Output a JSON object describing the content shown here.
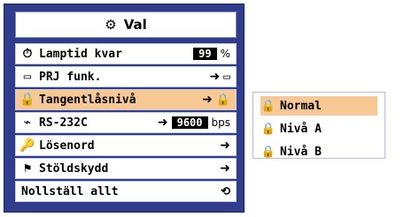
{
  "title": {
    "label": "Val",
    "icon": "options-icon"
  },
  "menu": {
    "items": [
      {
        "label": "Lamptid kvar",
        "value": "99",
        "unit": "%",
        "icon": "lamp-timer-icon"
      },
      {
        "label": "PRJ funk.",
        "icon": "projector-mode-icon"
      },
      {
        "label": "Tangentlåsnivå",
        "icon": "key-lock-icon",
        "selected": true
      },
      {
        "label": "RS-232C",
        "value": "9600",
        "unit": "bps",
        "icon": "rs232c-icon"
      },
      {
        "label": "Lösenord",
        "icon": "password-key-icon"
      },
      {
        "label": "Stöldskydd",
        "icon": "anti-theft-icon"
      },
      {
        "label": "Nollställ allt",
        "icon": "reset-all-icon"
      }
    ]
  },
  "submenu": {
    "items": [
      {
        "label": "Normal",
        "icon": "lock-icon",
        "selected": true
      },
      {
        "label": "Nivå A",
        "icon": "lock-icon"
      },
      {
        "label": "Nivå B",
        "icon": "lock-icon"
      }
    ]
  },
  "colors": {
    "panel": "#2f3d8c",
    "highlight": "#f7c894"
  }
}
